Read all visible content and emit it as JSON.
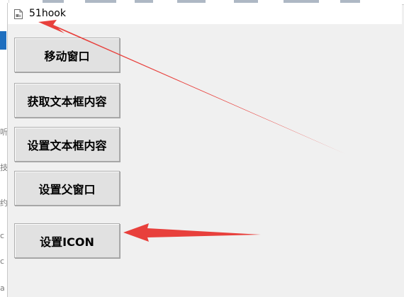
{
  "window": {
    "title": "51hook",
    "app_icon": "document-icon"
  },
  "buttons": [
    {
      "label": "移动窗口"
    },
    {
      "label": "获取文本框内容"
    },
    {
      "label": "设置文本框内容"
    },
    {
      "label": "设置父窗口"
    },
    {
      "label": "设置ICON"
    }
  ],
  "annotations": {
    "arrow_color": "#e8403c",
    "arrows": [
      {
        "name": "arrow-to-title",
        "points_to": "window title"
      },
      {
        "name": "arrow-to-set-icon-button",
        "points_to": "设置ICON button"
      }
    ]
  },
  "background_fragments": [
    "听",
    "技",
    "约",
    "c",
    "c",
    "a"
  ]
}
